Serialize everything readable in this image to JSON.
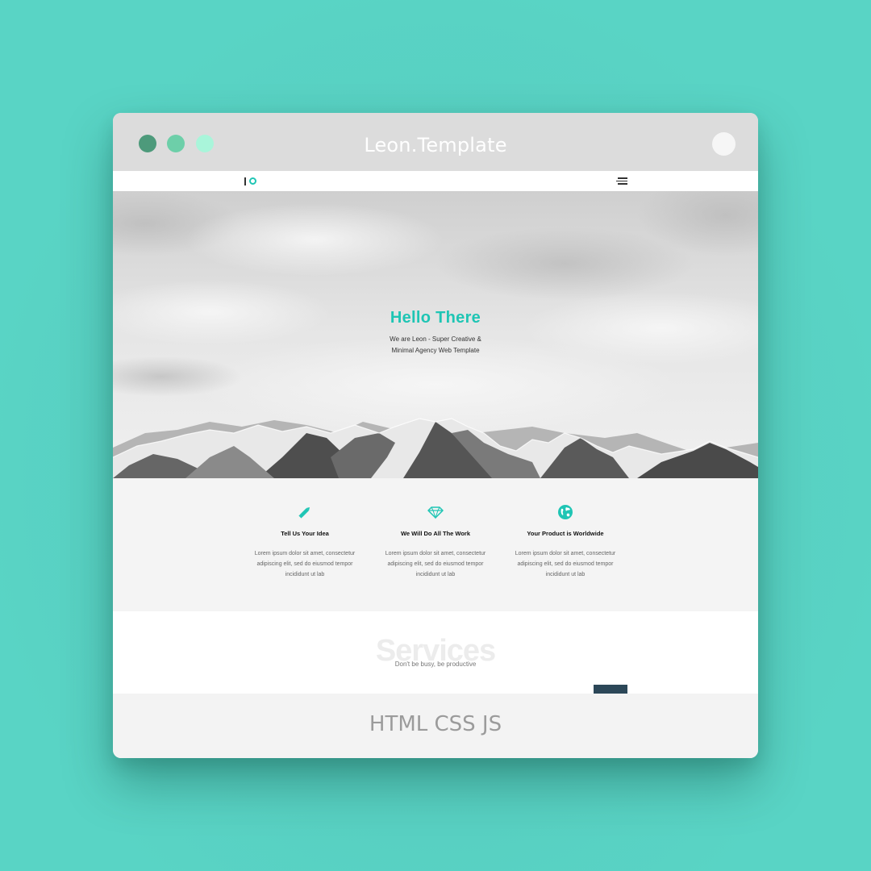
{
  "window": {
    "title": "Leon.Template",
    "dot_colors": [
      "#4d9a7b",
      "#6dcfa9",
      "#a9f5da"
    ]
  },
  "navbar": {
    "logo_icon": "logo-io-icon",
    "menu_icon": "hamburger-menu-icon"
  },
  "hero": {
    "title": "Hello There",
    "subtitle": "We are Leon - Super Creative & Minimal Agency Web Template",
    "accent_color": "#1fc5b4"
  },
  "features": [
    {
      "icon": "pencil-icon",
      "title": "Tell Us Your Idea",
      "text": "Lorem ipsum dolor sit amet, consectetur adipiscing elit, sed do eiusmod tempor incididunt ut lab"
    },
    {
      "icon": "diamond-icon",
      "title": "We Will Do All The Work",
      "text": "Lorem ipsum dolor sit amet, consectetur adipiscing elit, sed do eiusmod tempor incididunt ut lab"
    },
    {
      "icon": "globe-icon",
      "title": "Your Product is Worldwide",
      "text": "Lorem ipsum dolor sit amet, consectetur adipiscing elit, sed do eiusmod tempor incididunt ut lab"
    }
  ],
  "services": {
    "heading": "Services",
    "subheading": "Don't be busy, be productive"
  },
  "footer": {
    "text": "HTML CSS JS"
  }
}
